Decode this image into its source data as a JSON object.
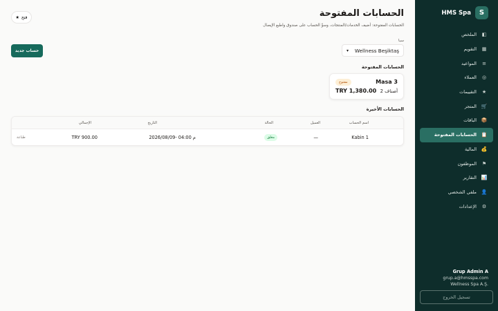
{
  "brand": {
    "logo": "S",
    "name": "HMS Spa"
  },
  "sidebar": {
    "items": [
      {
        "label": "الملخص",
        "icon": "◧"
      },
      {
        "label": "التقويم",
        "icon": "▦"
      },
      {
        "label": "المواعيد",
        "icon": "≡"
      },
      {
        "label": "العملاء",
        "icon": "◎"
      },
      {
        "label": "التقييمات",
        "icon": "★"
      },
      {
        "label": "المتجر",
        "icon": "🛒"
      },
      {
        "label": "الباقات",
        "icon": "📦"
      },
      {
        "label": "الحسابات المفتوحة",
        "icon": "📋"
      },
      {
        "label": "المالية",
        "icon": "💰"
      },
      {
        "label": "الموظفون",
        "icon": "⚑"
      },
      {
        "label": "التقارير",
        "icon": "📊"
      },
      {
        "label": "ملفي الشخصي",
        "icon": "👤"
      },
      {
        "label": "الإعدادات",
        "icon": "⚙"
      }
    ],
    "active_index": 7
  },
  "user": {
    "name": "Grup Admin A",
    "email": "grup.a@hmsspa.com",
    "company": "Wellness Spa A.Ş."
  },
  "logout_label": "تسجيل الخروج",
  "header": {
    "title": "الحسابات المفتوحة",
    "subtitle": "الحسابات المفتوحة: أضيف الخدمات/المنتجات، وسوِّ الحساب على صندوق واطبع الإيصال",
    "help_label": "فتح",
    "help_icon": "★"
  },
  "branch": {
    "label": "سبا",
    "value": "Wellness Beşiktaş",
    "chevron": "▾"
  },
  "new_account_label": "حساب جديد",
  "open_section": {
    "title": "الحسابات المفتوحة",
    "accounts": [
      {
        "name": "Masa 3",
        "badge": "مفتوح",
        "count": "2 أصناف",
        "total": "TRY 1,380.00"
      }
    ]
  },
  "recent_section": {
    "title": "الحسابات الأخيرة",
    "columns": [
      "اسم الحساب",
      "العميل",
      "الحالة",
      "التاريخ",
      "الإجمالي"
    ],
    "rows": [
      {
        "account": "Kabin 1",
        "customer": "—",
        "status": "مغلق",
        "date": "2026/08/09- 04:00 م",
        "total": "TRY 900.00",
        "action": "طباعة"
      }
    ]
  }
}
